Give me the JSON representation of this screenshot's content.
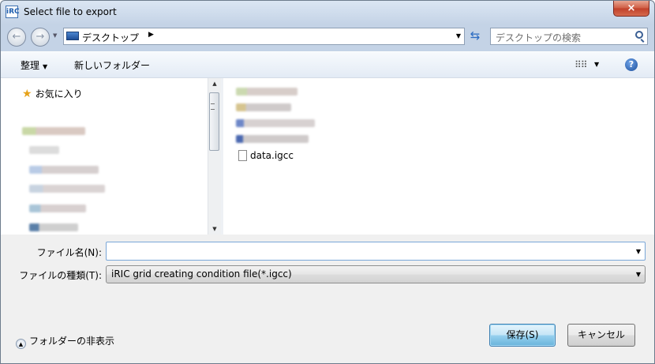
{
  "window": {
    "title": "Select file to export",
    "app_icon_label": "iRC",
    "close_label": "×"
  },
  "navigation": {
    "back_label": "←",
    "forward_label": "→",
    "address_location": "デスクトップ",
    "search_placeholder": "デスクトップの検索"
  },
  "toolbar": {
    "organize_label": "整理",
    "new_folder_label": "新しいフォルダー",
    "help_label": "?"
  },
  "nav_pane": {
    "favorites_label": "お気に入り"
  },
  "file_list": {
    "items": [
      {
        "name": "data.igcc",
        "icon": "document-icon"
      }
    ]
  },
  "form": {
    "filename_label": "ファイル名(N):",
    "filename_value": "",
    "filetype_label": "ファイルの種類(T):",
    "filetype_value": "iRIC grid creating condition file(*.igcc)"
  },
  "footer": {
    "hide_folders_label": "フォルダーの非表示",
    "save_label": "保存(S)",
    "cancel_label": "キャンセル"
  }
}
